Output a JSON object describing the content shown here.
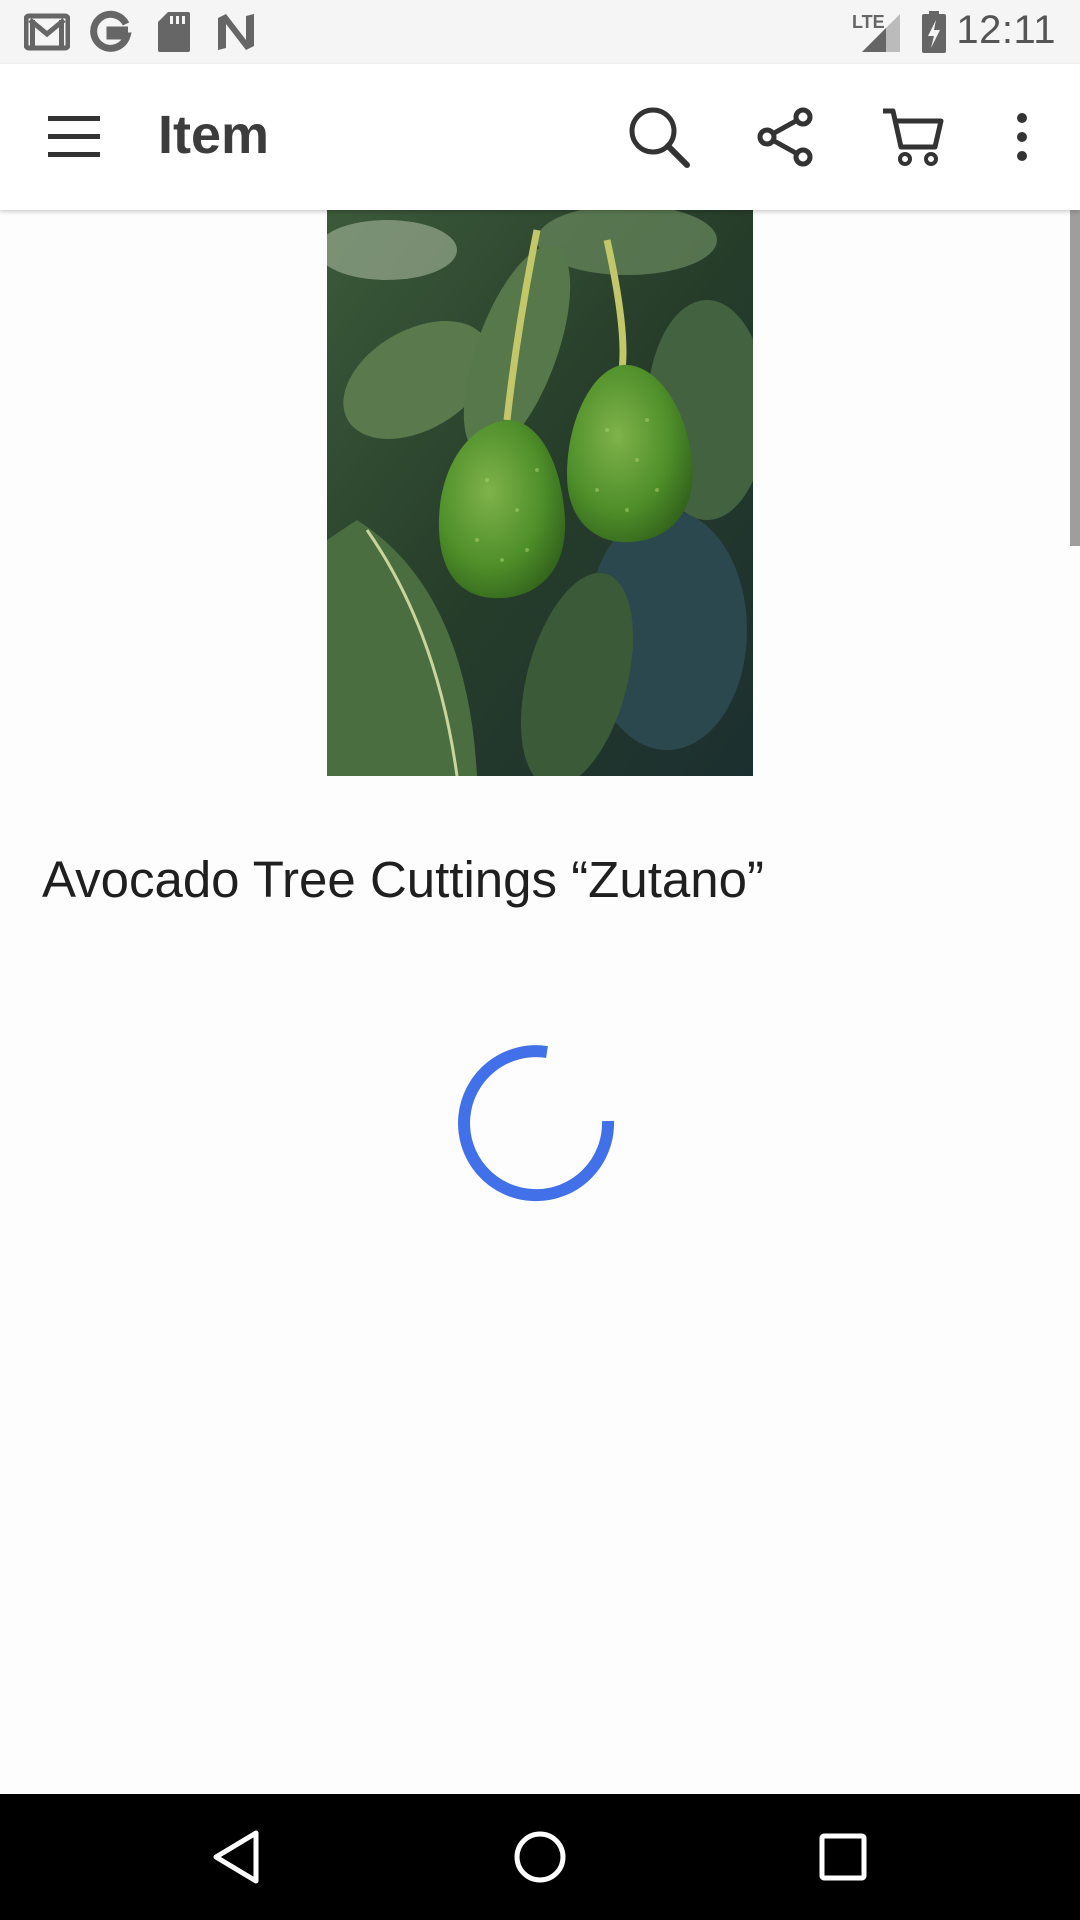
{
  "status_bar": {
    "time": "12:11",
    "network_label": "LTE",
    "notification_icons": [
      "gmail-icon",
      "google-icon",
      "sd-card-icon",
      "n-app-icon"
    ]
  },
  "app_bar": {
    "title": "Item",
    "icons": [
      "menu-icon",
      "search-icon",
      "share-icon",
      "cart-icon",
      "more-vert-icon"
    ]
  },
  "product": {
    "title": "Avocado Tree Cuttings “Zutano”",
    "image_subject": "two green avocados hanging on a tree branch"
  },
  "loading": {
    "state": "loading",
    "accent_color": "#4170e8"
  },
  "nav_bar": {
    "icons": [
      "back-icon",
      "home-icon",
      "recents-icon"
    ]
  }
}
